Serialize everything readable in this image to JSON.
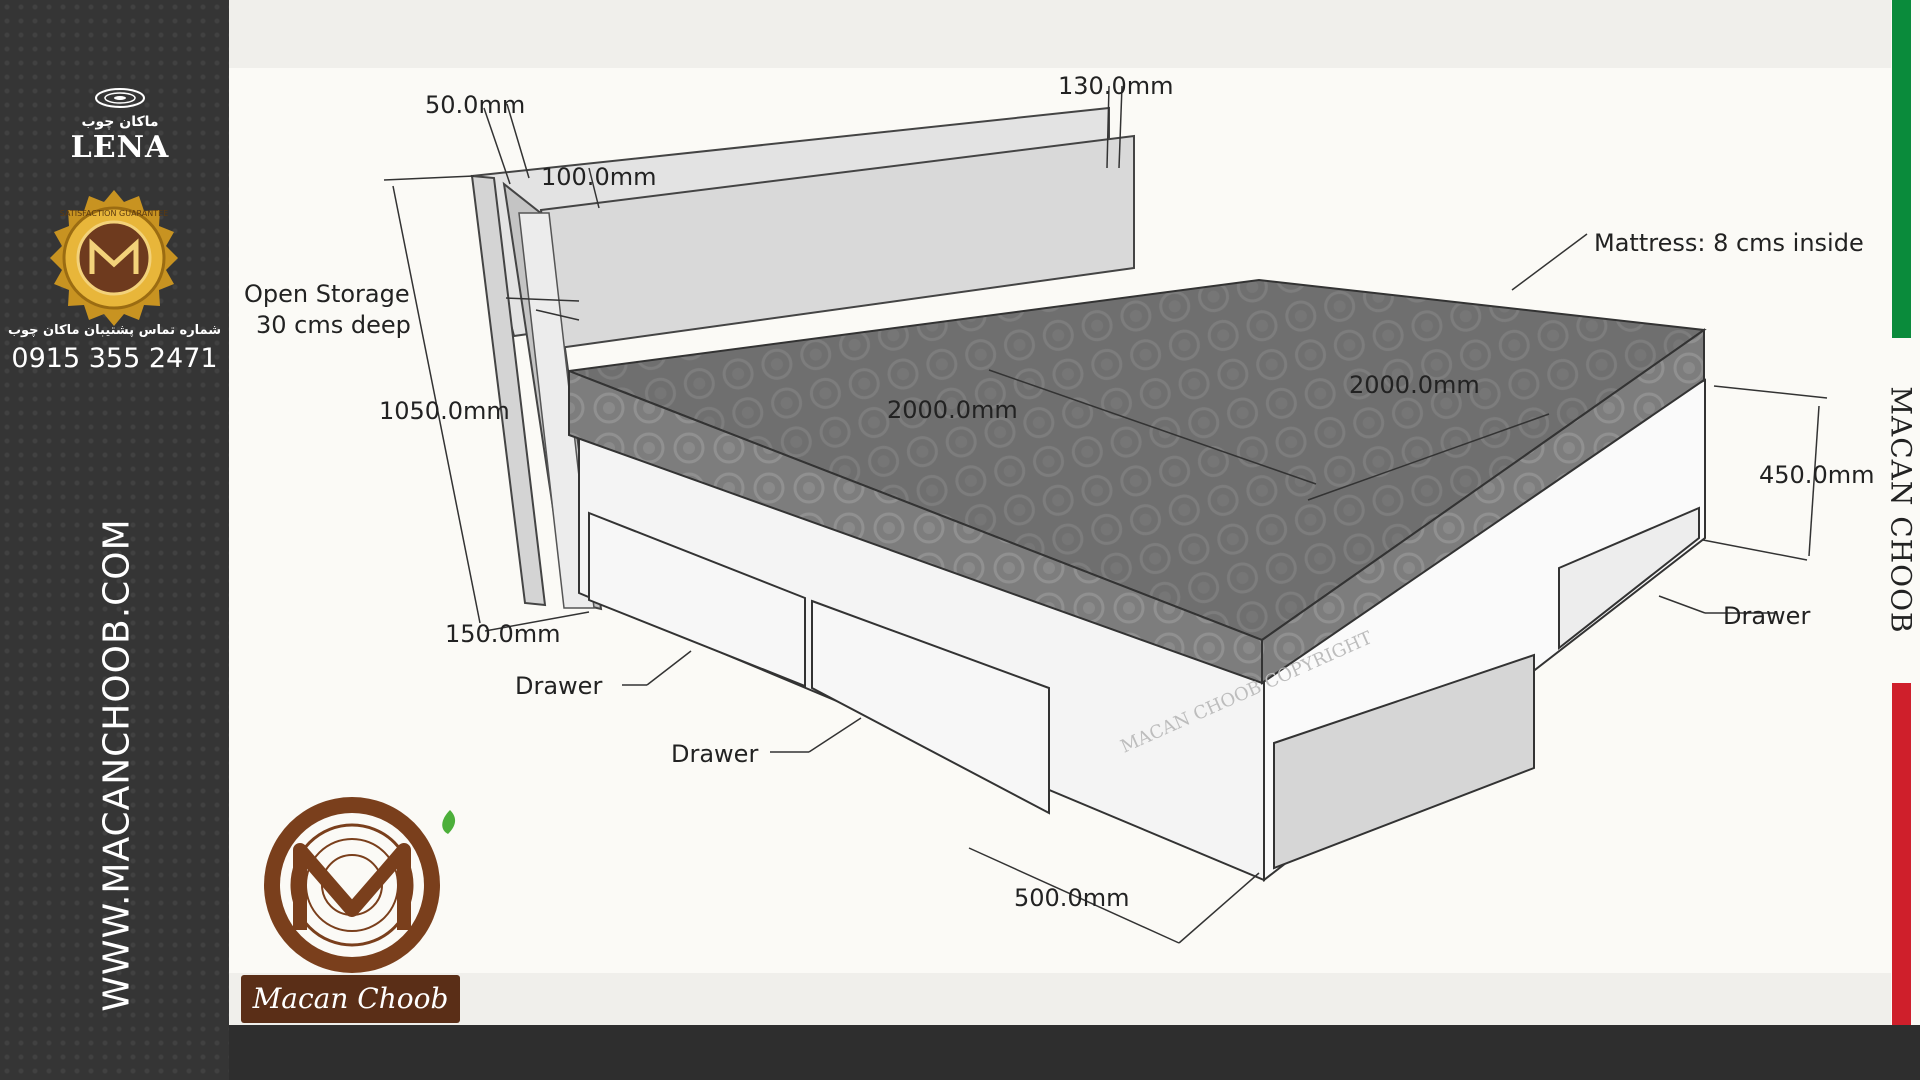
{
  "sidebar": {
    "brand_fa": "ماکان چوب",
    "model": "LENA",
    "seal_text": "SATISFACTION GUARANTEE",
    "support_fa": "شماره تماس پشتیبان ماکان چوب",
    "phone": "0915 355 2471",
    "url": "WWW.MACANCHOOB.COM",
    "logo_name": "Macan Choob"
  },
  "right_strip": {
    "brand": "MACAN CHOOB"
  },
  "diagram": {
    "dims": {
      "d50": "50.0mm",
      "d130": "130.0mm",
      "d100": "100.0mm",
      "d1050": "1050.0mm",
      "d150": "150.0mm",
      "d2000a": "2000.0mm",
      "d2000b": "2000.0mm",
      "d450": "450.0mm",
      "d500": "500.0mm"
    },
    "labels": {
      "open_storage_1": "Open Storage",
      "open_storage_2": "30 cms deep",
      "mattress": "Mattress: 8 cms inside",
      "drawer_left": "Drawer",
      "drawer_front": "Drawer",
      "drawer_right": "Drawer"
    },
    "watermark": "MACAN CHOOB COPYRIGHT"
  }
}
